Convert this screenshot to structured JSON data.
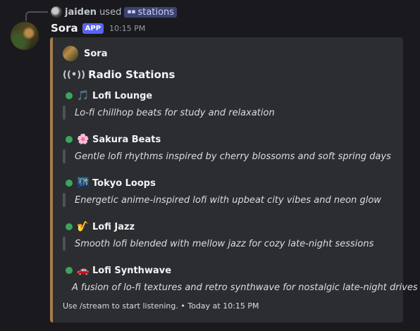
{
  "reply": {
    "user": "jaiden",
    "verb": "used",
    "command": "stations"
  },
  "message": {
    "username": "Sora",
    "badge": "APP",
    "timestamp": "10:15 PM"
  },
  "embed": {
    "accent_color": "#a67c4e",
    "author": "Sora",
    "title_icon": "radio-waves-icon",
    "title": "Radio Stations",
    "stations": [
      {
        "icon": "music-note-icon",
        "emoji": "🎵",
        "name": "Lofi Lounge",
        "description": "Lo-fi chillhop beats for study and relaxation",
        "status": "online"
      },
      {
        "icon": "cherry-blossom-icon",
        "emoji": "🌸",
        "name": "Sakura Beats",
        "description": "Gentle lofi rhythms inspired by cherry blossoms and soft spring days",
        "status": "online"
      },
      {
        "icon": "night-city-icon",
        "emoji": "🌃",
        "name": "Tokyo Loops",
        "description": "Energetic anime-inspired lofi with upbeat city vibes and neon glow",
        "status": "online"
      },
      {
        "icon": "saxophone-icon",
        "emoji": "🎷",
        "name": "Lofi Jazz",
        "description": "Smooth lofi blended with mellow jazz for cozy late-night sessions",
        "status": "online"
      },
      {
        "icon": "car-icon",
        "emoji": "🚗",
        "name": "Lofi Synthwave",
        "description": "A fusion of lo-fi textures and retro synthwave for nostalgic late-night drives",
        "status": "online"
      }
    ],
    "footer": "Use /stream to start listening. • Today at 10:15 PM"
  },
  "colors": {
    "background": "#1a1a1e",
    "embed_background": "#2b2d31",
    "online": "#3ba55c",
    "app_badge": "#5865f2"
  }
}
